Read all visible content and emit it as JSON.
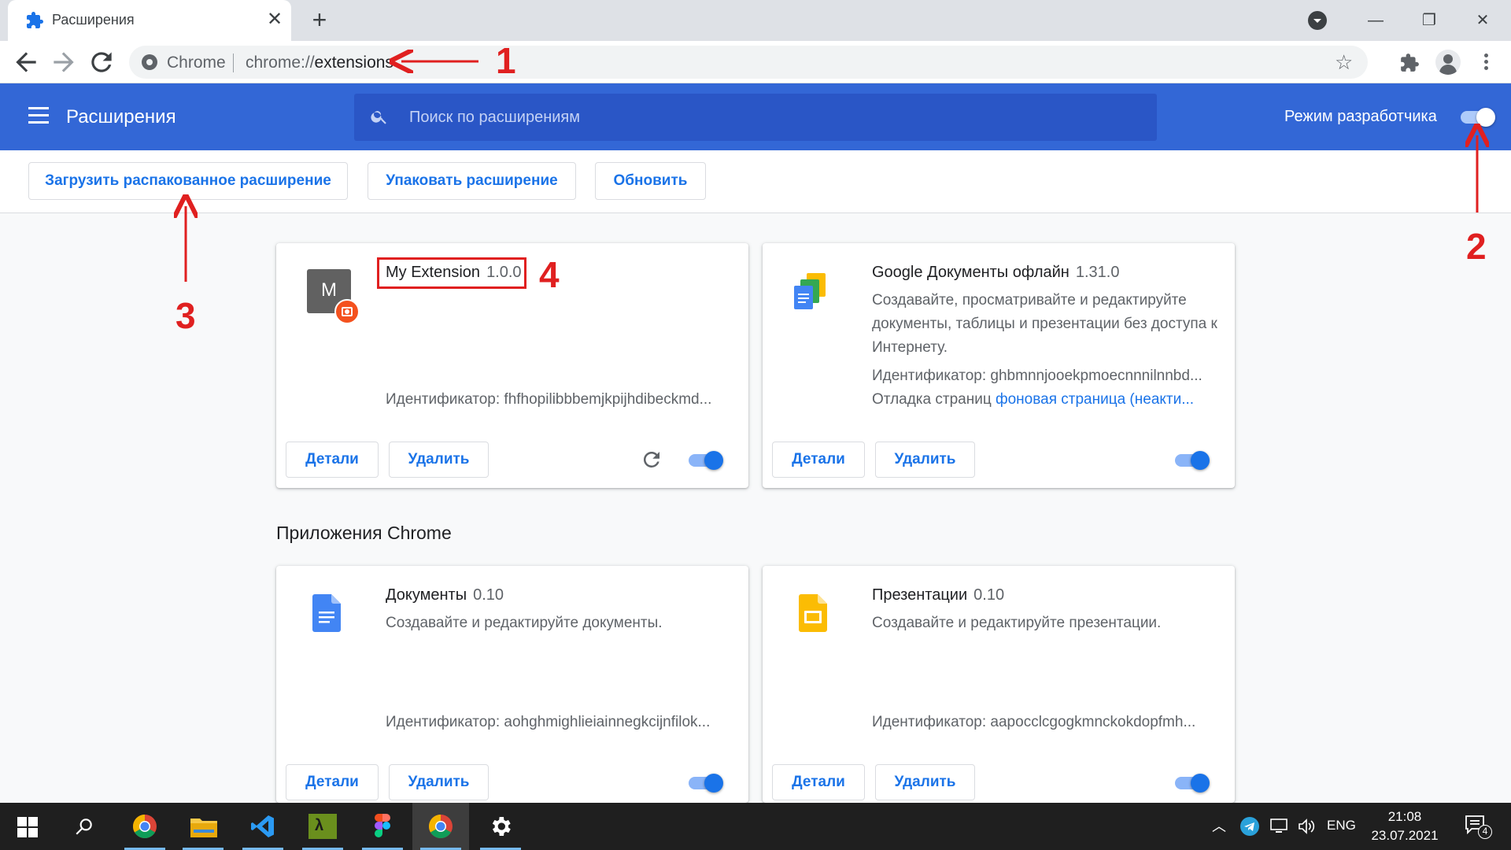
{
  "browser": {
    "tab_title": "Расширения",
    "tab_close": "✕",
    "new_tab": "+",
    "window_controls": {
      "minimize": "—",
      "restore": "❐",
      "close": "✕"
    },
    "omnibox": {
      "chip": "Chrome",
      "scheme": "chrome://",
      "path": "extensions"
    }
  },
  "header": {
    "title": "Расширения",
    "search_placeholder": "Поиск по расширениям",
    "dev_mode_label": "Режим разработчика",
    "dev_mode_on": true
  },
  "dev_bar": {
    "load_unpacked": "Загрузить распакованное расширение",
    "pack": "Упаковать расширение",
    "update": "Обновить"
  },
  "extensions": [
    {
      "icon_letter": "M",
      "name": "My Extension",
      "version": "1.0.0",
      "id_text": "Идентификатор: fhfhopilibbbemjkpijhdibeckmd...",
      "details": "Детали",
      "remove": "Удалить",
      "enabled": true
    },
    {
      "name": "Google Документы офлайн",
      "version": "1.31.0",
      "description": "Создавайте, просматривайте и редактируйте документы, таблицы и презентации без доступа к Интернету.",
      "id_text": "Идентификатор: ghbmnnjooekpmoecnnnilnnbd...",
      "inspect_label": "Отладка страниц",
      "inspect_link": "фоновая страница (неакти...",
      "details": "Детали",
      "remove": "Удалить",
      "enabled": true
    }
  ],
  "apps_heading": "Приложения Chrome",
  "apps": [
    {
      "name": "Документы",
      "version": "0.10",
      "description": "Создавайте и редактируйте документы.",
      "id_text": "Идентификатор: aohghmighlieiainnegkcijnfilok...",
      "details": "Детали",
      "remove": "Удалить",
      "enabled": true
    },
    {
      "name": "Презентации",
      "version": "0.10",
      "description": "Создавайте и редактируйте презентации.",
      "id_text": "Идентификатор: aapocclcgogkmnckokdopfmh...",
      "details": "Детали",
      "remove": "Удалить",
      "enabled": true
    }
  ],
  "annotations": {
    "n1": "1",
    "n2": "2",
    "n3": "3",
    "n4": "4"
  },
  "taskbar": {
    "lang": "ENG",
    "time": "21:08",
    "date": "23.07.2021",
    "notifications": "4"
  },
  "colors": {
    "accent": "#1a73e8",
    "header": "#3367d6",
    "annotation": "#e02020"
  }
}
